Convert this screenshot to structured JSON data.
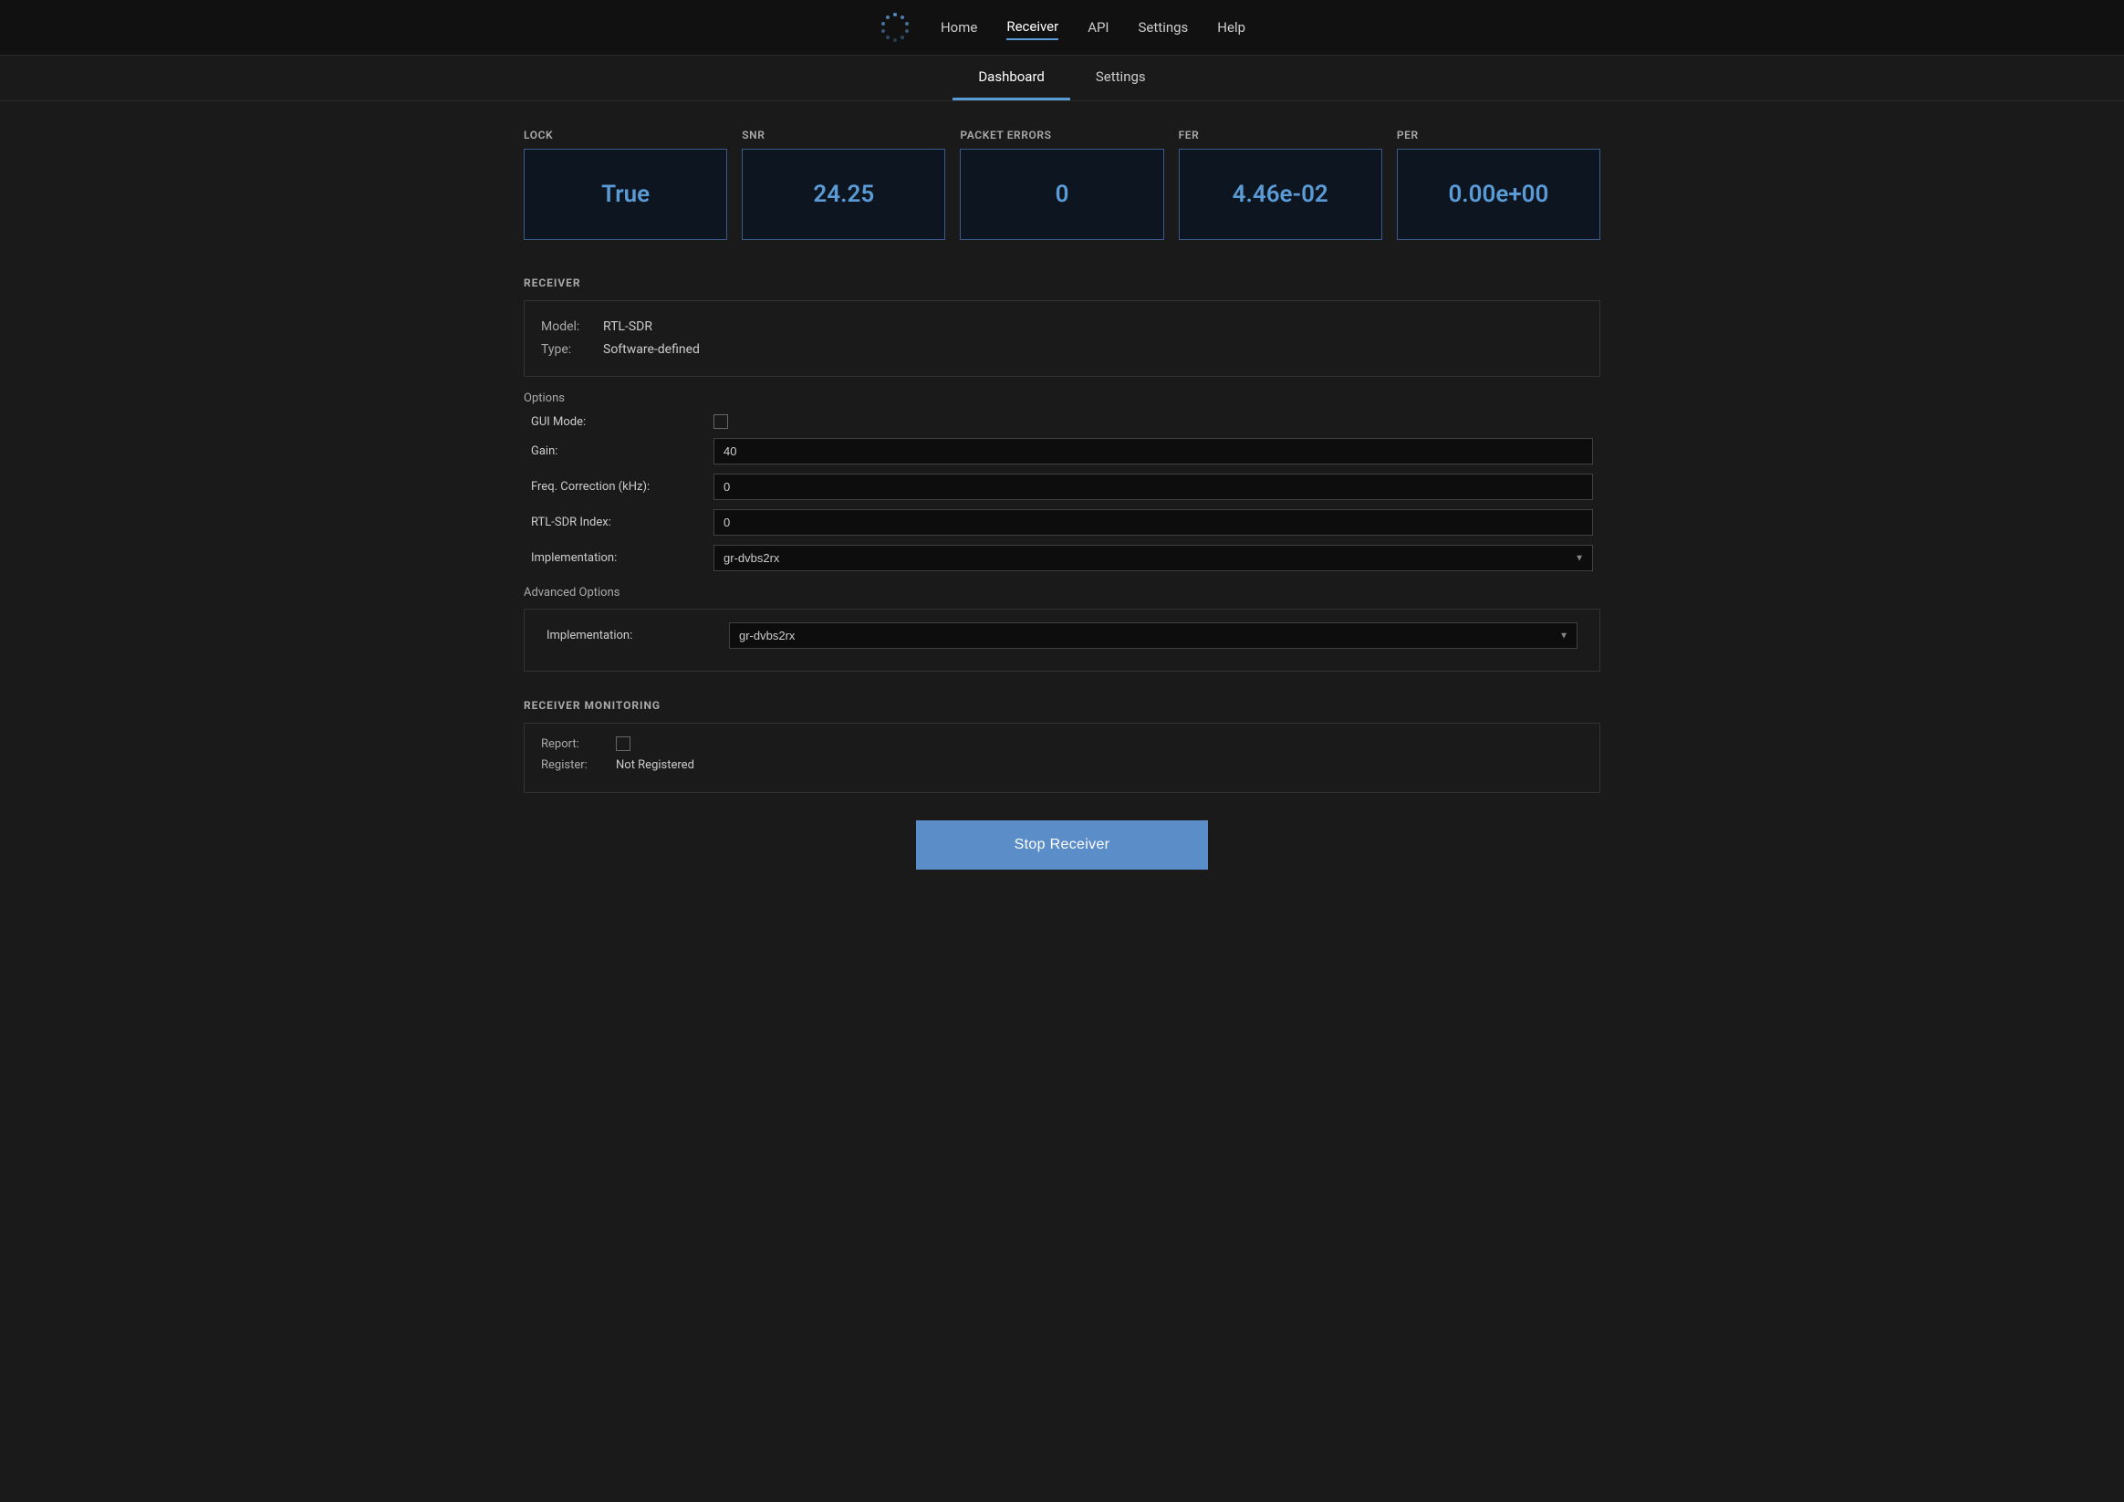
{
  "nav": {
    "links": [
      {
        "label": "Home",
        "active": false
      },
      {
        "label": "Receiver",
        "active": true
      },
      {
        "label": "API",
        "active": false
      },
      {
        "label": "Settings",
        "active": false
      },
      {
        "label": "Help",
        "active": false
      }
    ]
  },
  "sub_tabs": [
    {
      "label": "Dashboard",
      "active": true
    },
    {
      "label": "Settings",
      "active": false
    }
  ],
  "metrics": [
    {
      "id": "lock",
      "label": "LOCK",
      "value": "True"
    },
    {
      "id": "snr",
      "label": "SNR",
      "value": "24.25"
    },
    {
      "id": "packet_errors",
      "label": "PACKET ERRORS",
      "value": "0"
    },
    {
      "id": "fer",
      "label": "FER",
      "value": "4.46e-02"
    },
    {
      "id": "per",
      "label": "PER",
      "value": "0.00e+00"
    }
  ],
  "receiver_section": {
    "heading": "RECEIVER",
    "model_label": "Model:",
    "model_value": "RTL-SDR",
    "type_label": "Type:",
    "type_value": "Software-defined"
  },
  "options": {
    "heading": "Options",
    "gui_mode_label": "GUI Mode:",
    "gui_mode_checked": false,
    "gain_label": "Gain:",
    "gain_value": "40",
    "freq_correction_label": "Freq. Correction (kHz):",
    "freq_correction_value": "0",
    "rtl_sdr_index_label": "RTL-SDR Index:",
    "rtl_sdr_index_value": "0",
    "implementation_label": "Implementation:",
    "implementation_value": "gr-dvbs2rx",
    "implementation_options": [
      "gr-dvbs2rx"
    ]
  },
  "advanced_options": {
    "heading": "Advanced Options",
    "implementation_label": "Implementation:",
    "implementation_value": "gr-dvbs2rx",
    "implementation_options": [
      "gr-dvbs2rx"
    ]
  },
  "monitoring": {
    "heading": "RECEIVER MONITORING",
    "report_label": "Report:",
    "report_checked": false,
    "register_label": "Register:",
    "register_value": "Not Registered"
  },
  "stop_button": {
    "label": "Stop Receiver"
  }
}
